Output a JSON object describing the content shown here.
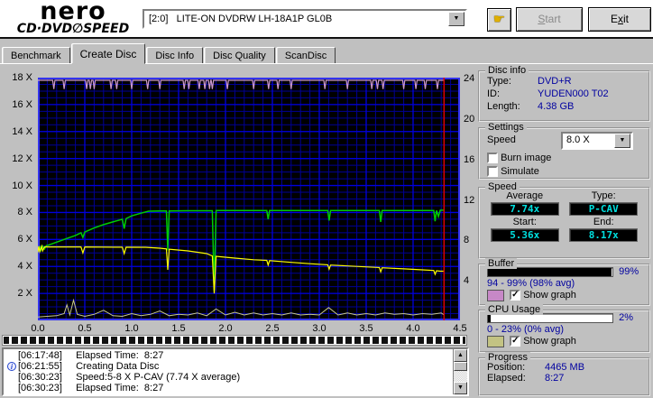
{
  "app": {
    "logo": {
      "line1": "nero",
      "line2a": "CD·DVD",
      "disc_glyph": "∅",
      "line2b": "SPEED"
    },
    "drive_selector_value": "[2:0]   LITE-ON DVDRW LH-18A1P GL0B",
    "start_button": {
      "text": "Start",
      "accel_index": 0
    },
    "exit_button": {
      "text": "Exit",
      "accel_index": 1
    }
  },
  "tabs": [
    {
      "label": "Benchmark",
      "active": false
    },
    {
      "label": "Create Disc",
      "active": true
    },
    {
      "label": "Disc Info",
      "active": false
    },
    {
      "label": "Disc Quality",
      "active": false
    },
    {
      "label": "ScanDisc",
      "active": false
    }
  ],
  "chart_data": {
    "type": "line",
    "x_range": [
      0,
      4.5
    ],
    "y_left_range": [
      0,
      18
    ],
    "y_right_range": [
      0,
      24
    ],
    "x_ticks": [
      [
        0,
        "0.0"
      ],
      [
        0.5,
        "0.5"
      ],
      [
        1,
        "1.0"
      ],
      [
        1.5,
        "1.5"
      ],
      [
        2,
        "2.0"
      ],
      [
        2.5,
        "2.5"
      ],
      [
        3,
        "3.0"
      ],
      [
        3.5,
        "3.5"
      ],
      [
        4,
        "4.0"
      ],
      [
        4.5,
        "4.5"
      ]
    ],
    "y_left_ticks": [
      [
        18,
        "18 X"
      ],
      [
        16,
        "16 X"
      ],
      [
        14,
        "14 X"
      ],
      [
        12,
        "12 X"
      ],
      [
        10,
        "10 X"
      ],
      [
        8,
        "8 X"
      ],
      [
        6,
        "6 X"
      ],
      [
        4,
        "4 X"
      ],
      [
        2,
        "2 X"
      ]
    ],
    "y_right_ticks": [
      [
        24,
        "24"
      ],
      [
        20,
        "20"
      ],
      [
        16,
        "16"
      ],
      [
        12,
        "12"
      ],
      [
        8,
        "8"
      ],
      [
        4,
        "4"
      ]
    ],
    "grid": {
      "bg": "#000000",
      "minor": "#000096",
      "major": "#0000dd",
      "border": "#3333ee",
      "minor_x_step": 0.1,
      "major_x_step": 0.5,
      "minor_y_step": 0.5,
      "major_y_step": 2
    },
    "cursor_x": 4.33,
    "cursor_color": "#dd0000",
    "series": [
      {
        "name": "write-speed",
        "color": "#00cc00",
        "width": 1.5,
        "points": [
          [
            0,
            5.15
          ],
          [
            0.02,
            5.45
          ],
          [
            0.03,
            5.2
          ],
          [
            0.05,
            5.5
          ],
          [
            0.07,
            5.3
          ],
          [
            0.09,
            5.55
          ],
          [
            0.12,
            5.6
          ],
          [
            0.2,
            5.8
          ],
          [
            0.3,
            6.05
          ],
          [
            0.4,
            6.3
          ],
          [
            0.46,
            6.5
          ],
          [
            0.48,
            6.15
          ],
          [
            0.5,
            6.55
          ],
          [
            0.6,
            6.85
          ],
          [
            0.7,
            7.1
          ],
          [
            0.8,
            7.3
          ],
          [
            0.9,
            7.5
          ],
          [
            0.92,
            6.8
          ],
          [
            0.94,
            7.55
          ],
          [
            1,
            7.75
          ],
          [
            1.1,
            7.95
          ],
          [
            1.18,
            8.1
          ],
          [
            1.3,
            8.12
          ],
          [
            1.37,
            8.12
          ],
          [
            1.385,
            5.2
          ],
          [
            1.4,
            8.12
          ],
          [
            1.6,
            8.13
          ],
          [
            1.86,
            8.13
          ],
          [
            1.88,
            2.2
          ],
          [
            1.9,
            8.15
          ],
          [
            2.2,
            8.15
          ],
          [
            2.44,
            8.15
          ],
          [
            2.455,
            7.5
          ],
          [
            2.47,
            8.15
          ],
          [
            2.8,
            8.15
          ],
          [
            3.09,
            8.15
          ],
          [
            3.105,
            7.4
          ],
          [
            3.12,
            8.15
          ],
          [
            3.5,
            8.15
          ],
          [
            3.64,
            8.15
          ],
          [
            3.655,
            7.3
          ],
          [
            3.67,
            8.15
          ],
          [
            4,
            8.15
          ],
          [
            4.22,
            8.15
          ],
          [
            4.235,
            7.35
          ],
          [
            4.25,
            8.15
          ],
          [
            4.27,
            7.7
          ],
          [
            4.29,
            8.17
          ],
          [
            4.33,
            8.17
          ]
        ]
      },
      {
        "name": "rotation-speed",
        "color": "#ffff00",
        "width": 1.2,
        "points": [
          [
            0,
            5.05
          ],
          [
            0.01,
            5.5
          ],
          [
            0.02,
            5.1
          ],
          [
            0.04,
            5.5
          ],
          [
            0.05,
            5.15
          ],
          [
            0.07,
            5.45
          ],
          [
            0.1,
            5.45
          ],
          [
            0.3,
            5.45
          ],
          [
            0.46,
            5.45
          ],
          [
            0.48,
            5
          ],
          [
            0.5,
            5.45
          ],
          [
            0.9,
            5.43
          ],
          [
            0.92,
            4.95
          ],
          [
            0.94,
            5.43
          ],
          [
            1.15,
            5.42
          ],
          [
            1.3,
            5.35
          ],
          [
            1.37,
            5.3
          ],
          [
            1.385,
            3.75
          ],
          [
            1.4,
            5.28
          ],
          [
            1.6,
            5.15
          ],
          [
            1.8,
            4.95
          ],
          [
            1.86,
            4.78
          ],
          [
            1.88,
            2
          ],
          [
            1.9,
            4.75
          ],
          [
            2.1,
            4.62
          ],
          [
            2.3,
            4.5
          ],
          [
            2.44,
            4.45
          ],
          [
            2.455,
            4.1
          ],
          [
            2.47,
            4.43
          ],
          [
            2.7,
            4.3
          ],
          [
            2.9,
            4.2
          ],
          [
            3.09,
            4.12
          ],
          [
            3.105,
            3.8
          ],
          [
            3.12,
            4.1
          ],
          [
            3.4,
            4
          ],
          [
            3.64,
            3.92
          ],
          [
            3.655,
            3.6
          ],
          [
            3.67,
            3.9
          ],
          [
            3.9,
            3.82
          ],
          [
            4.1,
            3.75
          ],
          [
            4.22,
            3.7
          ],
          [
            4.235,
            3.42
          ],
          [
            4.25,
            3.68
          ],
          [
            4.29,
            3.65
          ],
          [
            4.33,
            3.65
          ]
        ]
      },
      {
        "name": "cpu-usage-line",
        "color": "#c8c88c",
        "width": 1,
        "points": [
          [
            0,
            0.25
          ],
          [
            0.1,
            0.3
          ],
          [
            0.2,
            0.35
          ],
          [
            0.28,
            0.5
          ],
          [
            0.31,
            1.15
          ],
          [
            0.34,
            0.4
          ],
          [
            0.38,
            1.5
          ],
          [
            0.42,
            0.45
          ],
          [
            0.5,
            0.3
          ],
          [
            0.6,
            0.45
          ],
          [
            0.7,
            0.75
          ],
          [
            0.8,
            0.35
          ],
          [
            0.9,
            0.3
          ],
          [
            1,
            0.5
          ],
          [
            1.1,
            0.35
          ],
          [
            1.2,
            0.45
          ],
          [
            1.3,
            0.7
          ],
          [
            1.4,
            0.35
          ],
          [
            1.5,
            0.45
          ],
          [
            1.6,
            0.4
          ],
          [
            1.7,
            0.55
          ],
          [
            1.8,
            0.35
          ],
          [
            1.9,
            0.85
          ],
          [
            2,
            0.4
          ],
          [
            2.1,
            0.6
          ],
          [
            2.2,
            0.4
          ],
          [
            2.3,
            0.55
          ],
          [
            2.4,
            0.4
          ],
          [
            2.5,
            0.5
          ],
          [
            2.6,
            0.4
          ],
          [
            2.7,
            0.55
          ],
          [
            2.8,
            0.4
          ],
          [
            2.9,
            0.45
          ],
          [
            3,
            0.4
          ],
          [
            3.1,
            0.95
          ],
          [
            3.2,
            0.4
          ],
          [
            3.3,
            0.55
          ],
          [
            3.4,
            0.4
          ],
          [
            3.5,
            0.5
          ],
          [
            3.6,
            0.4
          ],
          [
            3.7,
            0.55
          ],
          [
            3.8,
            0.45
          ],
          [
            3.9,
            0.5
          ],
          [
            4,
            0.4
          ],
          [
            4.1,
            0.5
          ],
          [
            4.2,
            0.45
          ],
          [
            4.3,
            0.55
          ],
          [
            4.33,
            0.4
          ]
        ]
      }
    ],
    "buffer_line": {
      "name": "buffer-level",
      "color": "#cc99cc",
      "width": 1.2,
      "baseline": 17.8,
      "dip_depth": 0.65,
      "dip_halfwidth": 0.012,
      "end_x": 4.33,
      "dips": [
        0.17,
        0.28,
        0.52,
        0.56,
        0.6,
        0.78,
        0.84,
        1,
        1.17,
        1.3,
        1.56,
        1.61,
        1.72,
        1.78,
        1.83,
        1.86,
        2.02,
        2.3,
        2.46,
        2.56,
        2.7,
        3.06,
        3.3,
        3.56,
        3.62,
        3.68,
        3.9,
        4.03,
        4.13,
        4.26
      ]
    }
  },
  "panels": {
    "disc_info": {
      "title": "Disc info",
      "rows": [
        {
          "label": "Type:",
          "value": "DVD+R"
        },
        {
          "label": "ID:",
          "value": "YUDEN000 T02"
        },
        {
          "label": "Length:",
          "value": "4.38 GB"
        }
      ]
    },
    "settings": {
      "title": "Settings",
      "speed_label": "Speed",
      "speed_value": "8.0 X",
      "burn_image_label": "Burn image",
      "burn_image_checked": false,
      "simulate_label": "Simulate",
      "simulate_checked": false
    },
    "speed": {
      "title": "Speed",
      "average_label": "Average",
      "average_value": "7.74x",
      "type_label": "Type:",
      "type_value": "P-CAV",
      "start_label": "Start:",
      "start_value": "5.36x",
      "end_label": "End:",
      "end_value": "8.17x"
    },
    "buffer": {
      "title": "Buffer",
      "percent": 99,
      "percent_label": "99%",
      "range_text": "94 - 99% (98% avg)",
      "swatch_color": "#c788c7",
      "show_graph_label": "Show graph",
      "show_graph_checked": true
    },
    "cpu": {
      "title": "CPU Usage",
      "percent": 2,
      "percent_label": "2%",
      "range_text": "0 - 23% (0% avg)",
      "swatch_color": "#c3c383",
      "show_graph_label": "Show graph",
      "show_graph_checked": true
    },
    "progress": {
      "title": "Progress",
      "position_label": "Position:",
      "position_value": "4465 MB",
      "elapsed_label": "Elapsed:",
      "elapsed_value": "8:27"
    }
  },
  "log": {
    "lines": [
      {
        "icon": false,
        "time": "[06:17:48]",
        "text": "Elapsed Time:  8:27"
      },
      {
        "icon": true,
        "time": "[06:21:55]",
        "text": "Creating Data Disc"
      },
      {
        "icon": false,
        "time": "[06:30:23]",
        "text": "Speed:5-8 X P-CAV (7.74 X average)"
      },
      {
        "icon": false,
        "time": "[06:30:23]",
        "text": "Elapsed Time:  8:27"
      }
    ]
  }
}
